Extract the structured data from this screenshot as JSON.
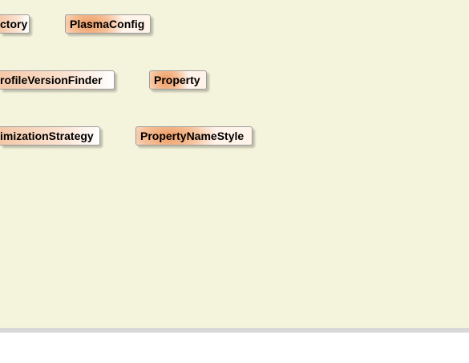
{
  "diagram": {
    "nodes": [
      {
        "id": "factory",
        "label": "ctory"
      },
      {
        "id": "plasma",
        "label": "PlasmaConfig"
      },
      {
        "id": "profile",
        "label": "rofileVersionFinder"
      },
      {
        "id": "property",
        "label": "Property"
      },
      {
        "id": "optim",
        "label": "imizationStrategy"
      },
      {
        "id": "propname",
        "label": "PropertyNameStyle"
      }
    ]
  },
  "colors": {
    "canvas_background": "#f4f4dc",
    "node_gradient_accent": "#ef9c64",
    "node_border": "#9c9c9c",
    "scroll_border": "#d8d8d8"
  }
}
